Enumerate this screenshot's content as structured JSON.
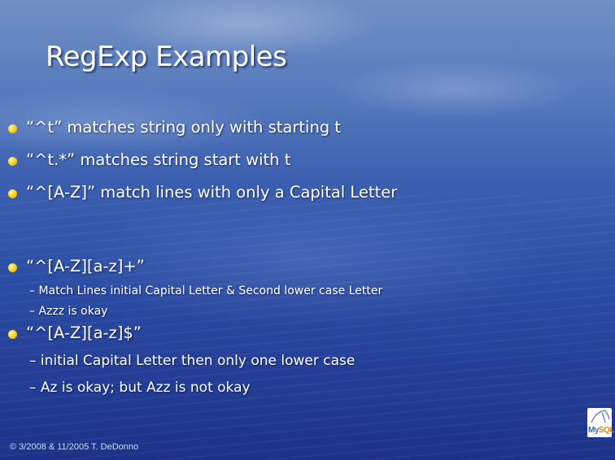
{
  "slide": {
    "title": "RegExp Examples",
    "bullets": [
      {
        "text": "“^t”  matches string only with starting t"
      },
      {
        "text": "“^t.*” matches string start with t"
      },
      {
        "text": "“^[A-Z]” match lines with only a Capital Letter"
      },
      {
        "text": "“^[A-Z][a-z]+”",
        "subs": [
          "– Match Lines initial Capital Letter & Second lower case Letter",
          "– Azzz is okay"
        ]
      },
      {
        "text": "“^[A-Z][a-z]$”",
        "subs": [
          "– initial Capital Letter then only one lower case",
          "– Az is okay; but Azz is not okay"
        ]
      }
    ],
    "footer": "© 3/2008 & 11/2005 T. DeDonno",
    "logo": {
      "prefix": "My",
      "suffix": "SQL"
    },
    "colors": {
      "bullet": "#f7cc00",
      "text": "#ffffff",
      "background": "#2c4ea5",
      "footer": "#c8d8f2"
    }
  }
}
